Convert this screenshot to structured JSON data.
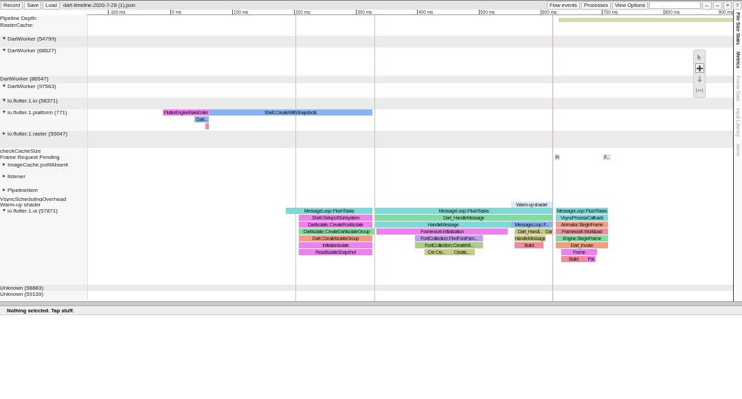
{
  "toolbar": {
    "left_buttons": [
      "Record",
      "Save",
      "Load"
    ],
    "filename": "dart-timeline-2020-7-28 (1).json",
    "right_buttons": [
      "Flow events",
      "Processes",
      "View Options"
    ],
    "nav_buttons": [
      "←",
      "→"
    ],
    "extra_buttons": [
      "»",
      "?"
    ]
  },
  "ruler": {
    "ticks": [
      "-100 ms",
      "0 ms",
      "100 ms",
      "200 ms",
      "300 ms",
      "400 ms",
      "500 ms",
      "600 ms",
      "700 ms",
      "800 ms",
      "900 ms"
    ]
  },
  "tracks": [
    {
      "label": "Pipeline Depth:",
      "shaded": false
    },
    {
      "label": "RasterCache:",
      "shaded": false
    },
    {
      "label": "DartWorker (54799)",
      "expanded": true,
      "shaded": true
    },
    {
      "label": "DartWorker (68627)",
      "expanded": true,
      "shaded": false
    },
    {
      "label": "DartWorker (86547)",
      "shaded": true
    },
    {
      "label": "DartWorker (97563)",
      "expanded": true,
      "shaded": false
    },
    {
      "label": "io.flutter.1.io (58371)",
      "expanded": true,
      "shaded": true
    },
    {
      "label": "io.flutter.1.platform (771)",
      "expanded": true,
      "shaded": false,
      "slices": [
        {
          "label": "FlutterEngineMainEnter",
          "color": "#f07ff0"
        },
        {
          "label": "Shell::CreateWithSnapshots",
          "color": "#8ab4f0"
        },
        {
          "label": "Dart...",
          "color": "#8ab4f0"
        },
        {
          "color": "#f08c9c"
        }
      ]
    },
    {
      "label": "io.flutter.1.raster (55047)",
      "expanded": false,
      "shaded": true
    },
    {
      "label": "checkCacheSize",
      "shaded": false
    },
    {
      "label": "Frame Request Pending",
      "shaded": false,
      "slices": [
        {
          "label": "Fr",
          "color": "#d8ecd8"
        },
        {
          "label": "F...",
          "color": "#d8ecd8"
        }
      ]
    },
    {
      "label": "ImageCache.putIfAbsent",
      "expanded": false,
      "shaded": false
    },
    {
      "label": "listener",
      "expanded": false,
      "shaded": false
    },
    {
      "label": "PipelineItem",
      "expanded": false,
      "shaded": false
    },
    {
      "label": "VsyncSchedulingOverhead",
      "shaded": false
    },
    {
      "label": "Warm-up shader",
      "shaded": false,
      "slices": [
        {
          "label": "Warm-up shader",
          "color": "#dceaf8"
        }
      ]
    },
    {
      "label": "io.flutter.1.ui (57871)",
      "expanded": true,
      "shaded": false,
      "slices": [
        {
          "label": "MessageLoop::FlushTasks",
          "color": "#80d8d8"
        },
        {
          "label": "MessageLoop::FlushTasks",
          "color": "#80d8d8"
        },
        {
          "label": "MessageLoop::FlushTasks",
          "color": "#80d8d8"
        },
        {
          "label": "Shell::SetupUISubsystem",
          "color": "#f07ff0"
        },
        {
          "label": "Dart_HandleMessage",
          "color": "#80dca0"
        },
        {
          "label": "VsyncProcessCallback",
          "color": "#80d8d8"
        },
        {
          "label": "DartIsolate::CreateRootIsolate",
          "color": "#f07ff0"
        },
        {
          "label": "HandleMessage",
          "color": "#80d8d8"
        },
        {
          "label": "MessageLoop::F...",
          "color": "#8ab4f0"
        },
        {
          "label": "Animator::BeginFrame",
          "color": "#f0a080"
        },
        {
          "label": "DartIsolate::CreateDartIsolateGroup",
          "color": "#80dca0"
        },
        {
          "label": "Framework initialization",
          "color": "#f07ff0"
        },
        {
          "label": "Dart_Handl...",
          "color": "#c8c888"
        },
        {
          "label": "Dar",
          "color": "#c8c888"
        },
        {
          "label": "Framework Workload",
          "color": "#f08c9c"
        },
        {
          "label": "Dart::CreateIsolateGroup",
          "color": "#f0a080"
        },
        {
          "label": "FontCollection::FindFontFam...",
          "color": "#c49cf0"
        },
        {
          "label": "HandleMessage",
          "color": "#c8c888"
        },
        {
          "label": "Engine::BeginFrame",
          "color": "#80dca0"
        },
        {
          "label": "InitializeIsolate",
          "color": "#f07ff0"
        },
        {
          "label": "FontCollection::CreateMi...",
          "color": "#a8d088"
        },
        {
          "label": "Build",
          "color": "#f08c9c"
        },
        {
          "label": "Dart_Invoke",
          "color": "#f0a080"
        },
        {
          "label": "ReadIsolateSnapshot",
          "color": "#f07ff0"
        },
        {
          "label": "Cre Cre...",
          "color": "#c8c888"
        },
        {
          "label": "Create...",
          "color": "#c8c888"
        },
        {
          "label": "Frame",
          "color": "#f07ff0"
        },
        {
          "label": "Build",
          "color": "#f08c9c"
        },
        {
          "label": "Pai",
          "color": "#f07ff0"
        }
      ]
    },
    {
      "label": "Unknown (58883)",
      "shaded": true
    },
    {
      "label": "Unknown (59139)",
      "shaded": false
    }
  ],
  "tools": [
    {
      "kind": "pointer",
      "selected": false
    },
    {
      "kind": "zoom",
      "selected": true
    },
    {
      "kind": "pan",
      "selected": false
    },
    {
      "kind": "timing",
      "selected": false
    }
  ],
  "side_tabs": [
    {
      "label": "File Size Stats",
      "disabled": false
    },
    {
      "label": "Metrics",
      "disabled": false
    },
    {
      "label": "Frame Data",
      "disabled": true
    },
    {
      "label": "Input Latency",
      "disabled": true
    },
    {
      "label": "Alerts",
      "disabled": true
    }
  ],
  "status": "Nothing selected. Tap stuff."
}
